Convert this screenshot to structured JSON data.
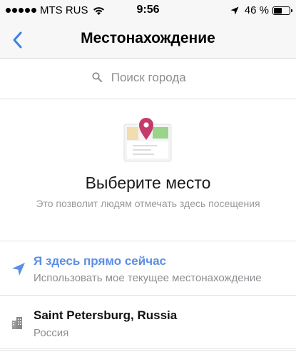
{
  "status_bar": {
    "carrier": "MTS RUS",
    "time": "9:56",
    "battery_percent": "46 %",
    "battery_level": 0.46,
    "icons": [
      "signal-dots-icon",
      "wifi-icon",
      "location-arrow-icon",
      "battery-icon"
    ]
  },
  "nav": {
    "title": "Местонахождение",
    "back_icon": "chevron-left-icon"
  },
  "search": {
    "placeholder": "Поиск города",
    "value": "",
    "icon": "search-icon"
  },
  "empty_state": {
    "illustration": "map-pin-icon",
    "title": "Выберите место",
    "subtitle": "Это позволит людям отмечать здесь посещения"
  },
  "list": {
    "current": {
      "icon": "location-arrow-icon",
      "title": "Я здесь прямо сейчас",
      "subtitle": "Использовать мое текущее местонахождение"
    },
    "city": {
      "icon": "city-buildings-icon",
      "title": "Saint Petersburg, Russia",
      "subtitle": "Россия"
    }
  },
  "colors": {
    "accent": "#5b8ee6",
    "pin": "#c43a6a",
    "map_green": "#9ad38a",
    "map_yellow": "#f2ddb0"
  }
}
